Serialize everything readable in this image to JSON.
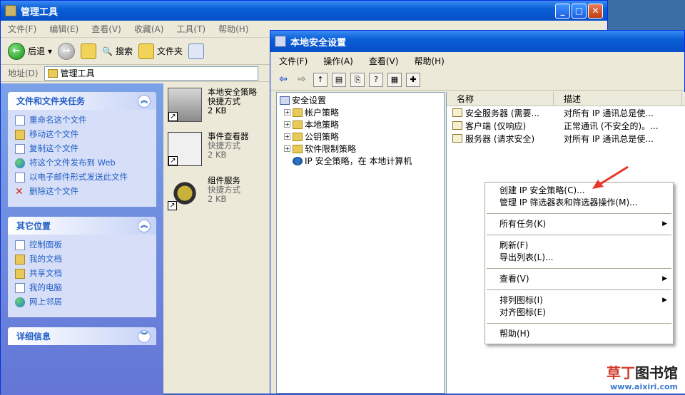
{
  "back_window": {
    "title": "管理工具",
    "menu": [
      "文件(F)",
      "编辑(E)",
      "查看(V)",
      "收藏(A)",
      "工具(T)",
      "帮助(H)"
    ],
    "toolbar": {
      "back": "后退",
      "search": "搜索",
      "folders": "文件夹"
    },
    "address": {
      "label": "地址(D)",
      "value": "管理工具"
    },
    "panels": {
      "file_tasks": {
        "title": "文件和文件夹任务",
        "items": [
          "重命名这个文件",
          "移动这个文件",
          "复制这个文件",
          "将这个文件发布到 Web",
          "以电子邮件形式发送此文件",
          "删除这个文件"
        ]
      },
      "other_places": {
        "title": "其它位置",
        "items": [
          "控制面板",
          "我的文档",
          "共享文档",
          "我的电脑",
          "网上邻居"
        ]
      },
      "details": {
        "title": "详细信息"
      }
    },
    "files": [
      {
        "name": "本地安全策略",
        "type": "快捷方式",
        "size": "2 KB"
      },
      {
        "name": "事件查看器",
        "type": "快捷方式",
        "size": "2 KB"
      },
      {
        "name": "组件服务",
        "type": "快捷方式",
        "size": "2 KB"
      }
    ]
  },
  "front_window": {
    "title": "本地安全设置",
    "menu": [
      "文件(F)",
      "操作(A)",
      "查看(V)",
      "帮助(H)"
    ],
    "tree": {
      "root": "安全设置",
      "children": [
        "帐户策略",
        "本地策略",
        "公钥策略",
        "软件限制策略",
        "IP 安全策略，在 本地计算机"
      ]
    },
    "list": {
      "columns": [
        "名称",
        "描述"
      ],
      "rows": [
        {
          "name": "安全服务器 (需要...",
          "desc": "对所有 IP 通讯总是使..."
        },
        {
          "name": "客户端 (仅响应)",
          "desc": "正常通讯 (不安全的)。..."
        },
        {
          "name": "服务器 (请求安全)",
          "desc": "对所有 IP 通讯总是使..."
        }
      ]
    }
  },
  "context_menu": {
    "create": "创建 IP 安全策略(C)...",
    "manage": "管理 IP 筛选器表和筛选器操作(M)...",
    "all_tasks": "所有任务(K)",
    "refresh": "刷新(F)",
    "export": "导出列表(L)...",
    "view": "查看(V)",
    "arrange": "排列图标(I)",
    "line_up": "对齐图标(E)",
    "help": "帮助(H)"
  },
  "watermark": {
    "line1_a": "草丁",
    "line1_b": "图书馆",
    "line2": "www.aixiri.com"
  },
  "colors": {
    "accent": "#0a5fd7",
    "arrow": "#e8372a"
  }
}
